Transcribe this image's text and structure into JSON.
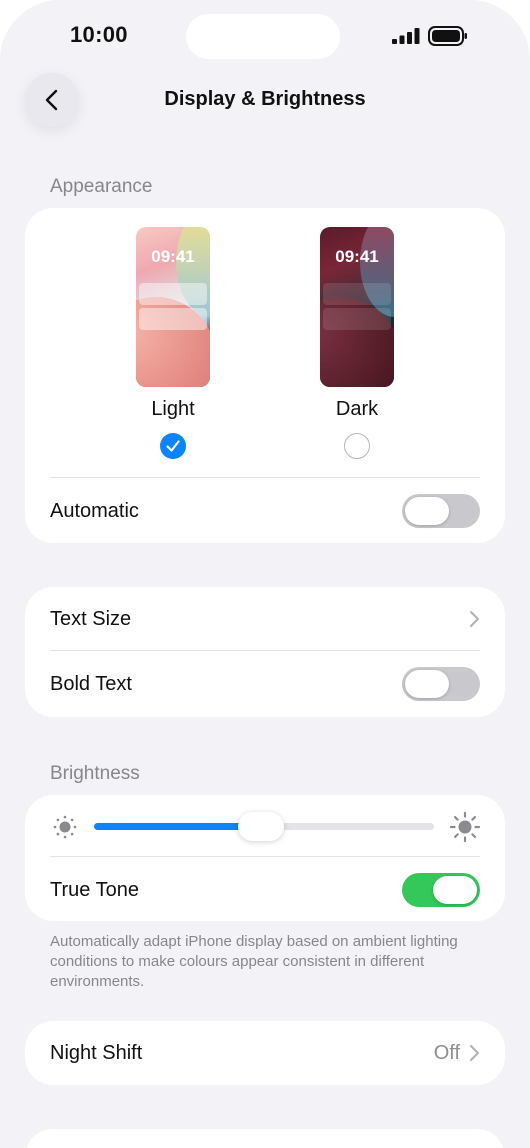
{
  "status_bar": {
    "time": "10:00"
  },
  "header": {
    "title": "Display & Brightness"
  },
  "appearance": {
    "section_label": "Appearance",
    "light": {
      "label": "Light",
      "preview_time": "09:41",
      "selected": true
    },
    "dark": {
      "label": "Dark",
      "preview_time": "09:41",
      "selected": false
    },
    "automatic": {
      "label": "Automatic",
      "on": false
    }
  },
  "text_group": {
    "text_size_label": "Text Size",
    "bold_text": {
      "label": "Bold Text",
      "on": false
    }
  },
  "brightness": {
    "section_label": "Brightness",
    "level": 0.49,
    "true_tone": {
      "label": "True Tone",
      "on": true
    },
    "footnote": "Automatically adapt iPhone display based on ambient lighting conditions to make colours appear consistent in different environments."
  },
  "night_shift": {
    "label": "Night Shift",
    "value": "Off"
  },
  "colors": {
    "accent": "#0a84ff",
    "toggle_on": "#34c759",
    "toggle_off": "#c8c8cd"
  }
}
